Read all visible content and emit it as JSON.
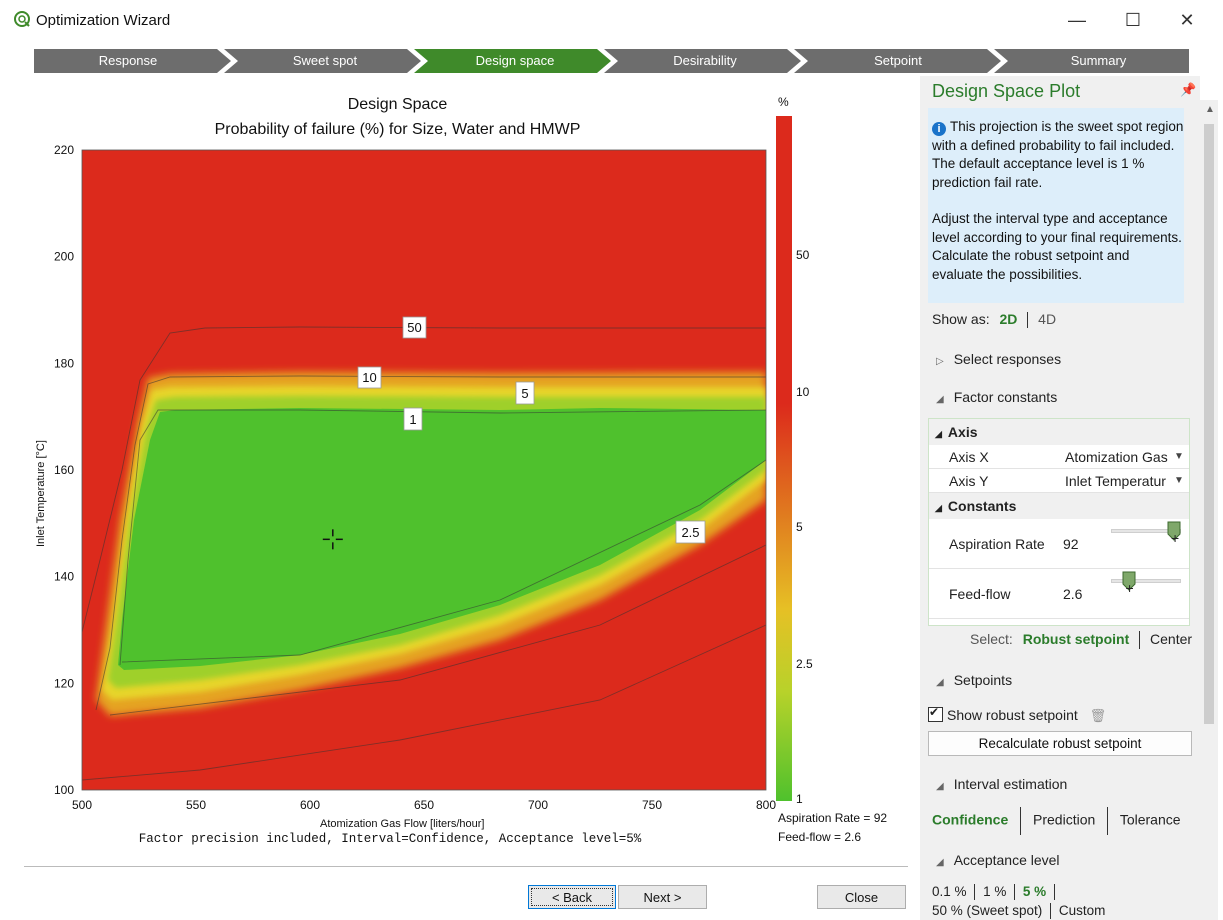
{
  "window": {
    "title": "Optimization Wizard",
    "controls": {
      "minimize": "—",
      "maximize": "☐",
      "close": "✕"
    }
  },
  "steps": [
    {
      "label": "Response",
      "active": false
    },
    {
      "label": "Sweet spot",
      "active": false
    },
    {
      "label": "Design space",
      "active": true
    },
    {
      "label": "Desirability",
      "active": false
    },
    {
      "label": "Setpoint",
      "active": false
    },
    {
      "label": "Summary",
      "active": false
    }
  ],
  "colors": {
    "step_active": "#3f8a2a",
    "step_inactive": "#6d6d6d",
    "accent_green": "#2b7c2b",
    "info_bg": "#ddeefa"
  },
  "chart_data": {
    "type": "heatmap",
    "title": "Design Space",
    "subtitle": "Probability of failure (%) for Size, Water and HMWP",
    "xlabel": "Atomization Gas Flow [liters/hour]",
    "ylabel": "Inlet Temperature [°C]",
    "xlim": [
      500,
      800
    ],
    "ylim": [
      100,
      220
    ],
    "xticks": [
      500,
      550,
      600,
      650,
      700,
      750,
      800
    ],
    "yticks": [
      100,
      120,
      140,
      160,
      180,
      200,
      220
    ],
    "colorbar": {
      "unit": "%",
      "ticks": [
        "50",
        "10",
        "5",
        "2.5",
        "1"
      ]
    },
    "contour_labels": [
      "50",
      "10",
      "5",
      "1",
      "2.5"
    ],
    "marker": {
      "x": 610,
      "y": 147,
      "label": "robust setpoint"
    },
    "footer": "Factor precision included, Interval=Confidence, Acceptance level=5%",
    "side_notes": [
      "Aspiration Rate = 92",
      "Feed-flow = 2.6"
    ]
  },
  "buttons": {
    "back": "< Back",
    "next": "Next >",
    "close": "Close"
  },
  "panel": {
    "title": "Design Space Plot",
    "info_p1": "This projection is the sweet spot region with a defined probability to fail included. The default acceptance level is 1 % prediction fail rate.",
    "info_p2": "Adjust the interval type and acceptance level according to your final requirements. Calculate the robust setpoint and evaluate the possibilities.",
    "show_as_label": "Show as:",
    "show_as_2d": "2D",
    "show_as_4d": "4D",
    "select_responses": "Select responses",
    "factor_constants": "Factor constants",
    "grid": {
      "axis_group": "Axis",
      "axis_x_label": "Axis X",
      "axis_x_value": "Atomization Gas",
      "axis_y_label": "Axis Y",
      "axis_y_value": "Inlet Temperatur",
      "constants_group": "Constants",
      "aspiration_label": "Aspiration Rate",
      "aspiration_value": "92",
      "aspiration_level": 0.9,
      "feedflow_label": "Feed-flow",
      "feedflow_value": "2.6",
      "feedflow_level": 0.25
    },
    "select_label": "Select:",
    "select_robust": "Robust setpoint",
    "select_center": "Center",
    "setpoints": "Setpoints",
    "show_robust": "Show robust setpoint",
    "recalc": "Recalculate robust setpoint",
    "interval_estimation": "Interval estimation",
    "interval_confidence": "Confidence",
    "interval_prediction": "Prediction",
    "interval_tolerance": "Tolerance",
    "acceptance_level": "Acceptance level",
    "acc_01": "0.1 %",
    "acc_1": "1 %",
    "acc_5": "5 %",
    "acc_50": "50 % (Sweet spot)",
    "acc_custom": "Custom"
  }
}
